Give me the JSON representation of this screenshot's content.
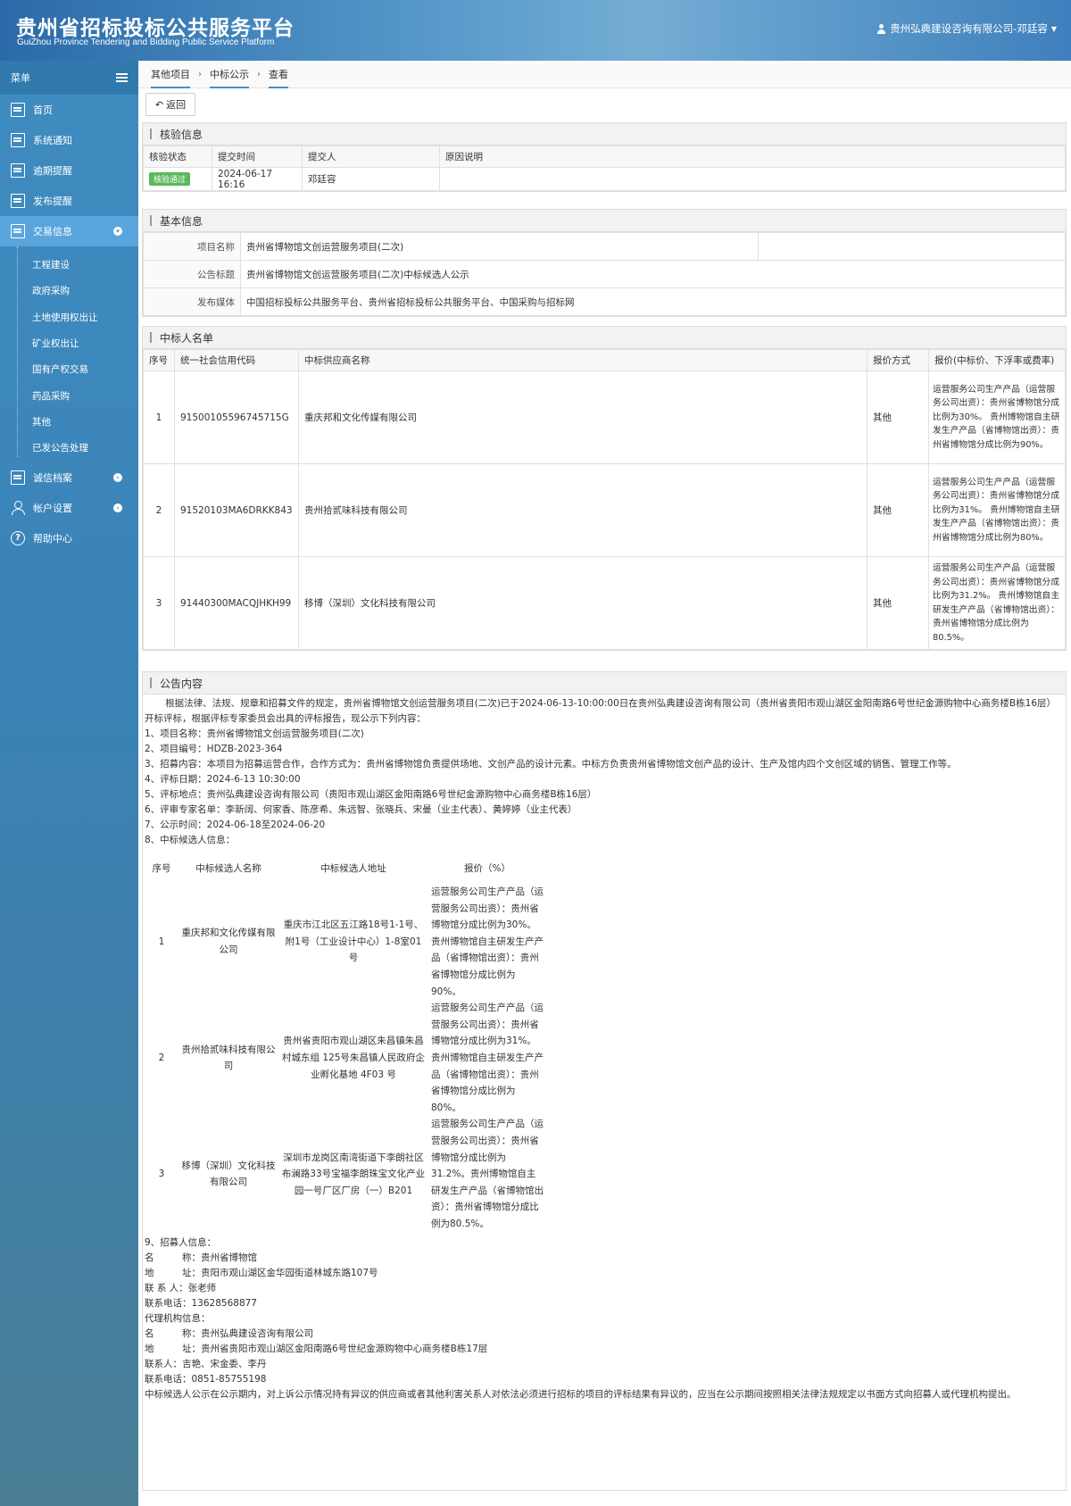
{
  "header": {
    "title": "贵州省招标投标公共服务平台",
    "subtitle": "GuiZhou Province Tendering and Bidding Public Service Platform",
    "user": "贵州弘典建设咨询有限公司-邓廷容"
  },
  "sidebar": {
    "menu_label": "菜单",
    "items": [
      {
        "label": "首页",
        "icon": "home-icon"
      },
      {
        "label": "系统通知",
        "icon": "monitor-icon"
      },
      {
        "label": "逾期提醒",
        "icon": "list-icon"
      },
      {
        "label": "发布提醒",
        "icon": "list-icon"
      },
      {
        "label": "交易信息",
        "icon": "list-icon"
      },
      {
        "label": "诚信档案",
        "icon": "list-icon"
      },
      {
        "label": "帐户设置",
        "icon": "user-icon"
      },
      {
        "label": "帮助中心",
        "icon": "help-icon"
      }
    ],
    "sub_items": [
      "工程建设",
      "政府采购",
      "土地使用权出让",
      "矿业权出让",
      "国有产权交易",
      "药品采购",
      "其他",
      "已发公告处理"
    ]
  },
  "breadcrumb": [
    "其他项目",
    "中标公示",
    "查看"
  ],
  "back_label": "返回",
  "verify": {
    "title": "核验信息",
    "headers": [
      "核验状态",
      "提交时间",
      "提交人",
      "原因说明"
    ],
    "status": "核验通过",
    "time": "2024-06-17 16:16",
    "submitter": "邓廷容",
    "reason": ""
  },
  "basic": {
    "title": "基本信息",
    "rows": [
      {
        "k": "项目名称",
        "v": "贵州省博物馆文创运营服务项目(二次)"
      },
      {
        "k": "公告标题",
        "v": "贵州省博物馆文创运营服务项目(二次)中标候选人公示"
      },
      {
        "k": "发布媒体",
        "v": "中国招标投标公共服务平台、贵州省招标投标公共服务平台、中国采购与招标网"
      }
    ]
  },
  "winners": {
    "title": "中标人名单",
    "headers": [
      "序号",
      "统一社会信用代码",
      "中标供应商名称",
      "报价方式",
      "报价(中标价、下浮率或费率)"
    ],
    "rows": [
      {
        "no": "1",
        "code": "91500105596745715G",
        "name": "重庆邦和文化传媒有限公司",
        "method": "其他",
        "price": "运营服务公司生产产品（运营服务公司出资）：贵州省博物馆分成比例为30%。 贵州博物馆自主研发生产产品（省博物馆出资）：贵州省博物馆分成比例为90%。"
      },
      {
        "no": "2",
        "code": "91520103MA6DRKK843",
        "name": "贵州拾贰味科技有限公司",
        "method": "其他",
        "price": "运营服务公司生产产品（运营服务公司出资）：贵州省博物馆分成比例为31%。 贵州博物馆自主研发生产产品（省博物馆出资）：贵州省博物馆分成比例为80%。"
      },
      {
        "no": "3",
        "code": "91440300MACQJHKH99",
        "name": "移博（深圳）文化科技有限公司",
        "method": "其他",
        "price": "运营服务公司生产产品（运营服务公司出资）：贵州省博物馆分成比例为31.2%。 贵州博物馆自主研发生产产品（省博物馆出资）：贵州省博物馆分成比例为80.5%。"
      }
    ]
  },
  "notice": {
    "title": "公告内容",
    "intro": "根据法律、法规、规章和招募文件的规定，贵州省博物馆文创运营服务项目(二次)已于2024-06-13-10:00:00日在贵州弘典建设咨询有限公司（贵州省贵阳市观山湖区金阳南路6号世纪金源购物中心商务楼B栋16层）开标评标，根据评标专家委员会出具的评标报告，现公示下列内容：",
    "lines": [
      "1、项目名称：贵州省博物馆文创运营服务项目(二次)",
      "2、项目编号：HDZB-2023-364",
      "3、招募内容：本项目为招募运营合作，合作方式为：贵州省博物馆负责提供场地、文创产品的设计元素。中标方负责贵州省博物馆文创产品的设计、生产及馆内四个文创区域的销售、管理工作等。",
      "4、评标日期：2024-6-13  10:30:00",
      "5、评标地点：贵州弘典建设咨询有限公司（贵阳市观山湖区金阳南路6号世纪金源购物中心商务楼B栋16层）",
      "6、评审专家名单：李新阔、何家香、陈彦希、朱远智、张晓兵、宋曼（业主代表）、黄婷婷（业主代表）",
      "7、公示时间：2024-06-18至2024-06-20",
      "8、中标候选人信息："
    ],
    "cand_headers": [
      "序号",
      "中标候选人名称",
      "中标候选人地址",
      "报价（%）"
    ],
    "candidates": [
      {
        "no": "1",
        "name": "重庆邦和文化传媒有限公司",
        "addr": "重庆市江北区五江路18号1-1号、附1号（工业设计中心）1-8室01号",
        "price": "运营服务公司生产产品（运营服务公司出资）：贵州省博物馆分成比例为30%。贵州博物馆自主研发生产产品（省博物馆出资）：贵州省博物馆分成比例为90%。"
      },
      {
        "no": "2",
        "name": "贵州拾贰味科技有限公司",
        "addr": "贵州省贵阳市观山湖区朱昌镇朱昌村城东组 125号朱昌镇人民政府企业孵化基地 4F03 号",
        "price": "运营服务公司生产产品（运营服务公司出资）：贵州省博物馆分成比例为31%。贵州博物馆自主研发生产产品（省博物馆出资）：贵州省博物馆分成比例为80%。"
      },
      {
        "no": "3",
        "name": "移博（深圳）文化科技有限公司",
        "addr": "深圳市龙岗区南湾街道下李朗社区布澜路33号宝福李朗珠宝文化产业园一号厂区厂房（一）B201",
        "price": "运营服务公司生产产品（运营服务公司出资）：贵州省博物馆分成比例为31.2%。贵州博物馆自主研发生产产品（省博物馆出资）：贵州省博物馆分成比例为80.5%。"
      }
    ],
    "tail": [
      "9、招募人信息：",
      "名　　　称：贵州省博物馆",
      "地　　　址：贵阳市观山湖区金华园街道林城东路107号",
      "联 系 人：张老师",
      "联系电话：13628568877",
      "代理机构信息：",
      "名　　　称：贵州弘典建设咨询有限公司",
      "地　　　址：贵州省贵阳市观山湖区金阳南路6号世纪金源购物中心商务楼B栋17层",
      "联系人：吉艳、宋金委、李丹",
      "联系电话：0851-85755198",
      "中标候选人公示在公示期内，对上诉公示情况持有异议的供应商或者其他利害关系人对依法必须进行招标的项目的评标结果有异议的，应当在公示期间按照相关法律法规规定以书面方式向招募人或代理机构提出。"
    ]
  }
}
